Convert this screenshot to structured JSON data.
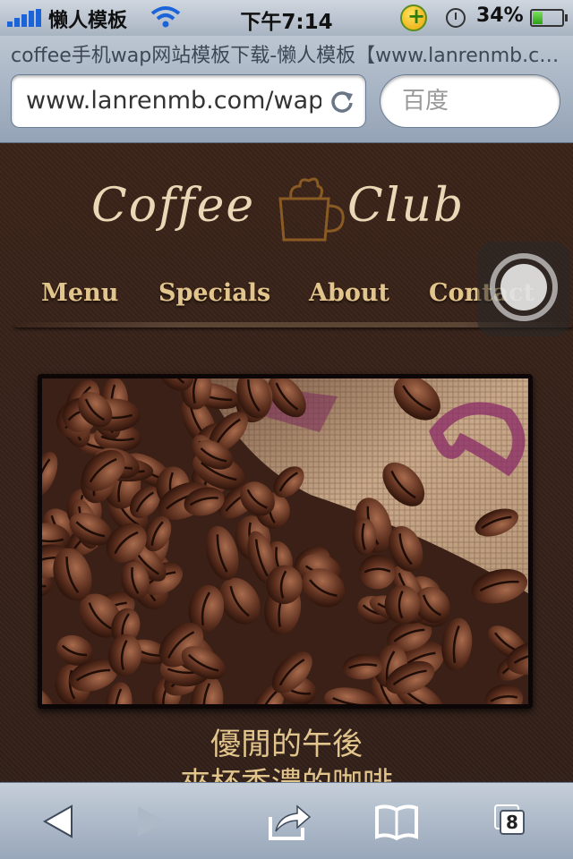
{
  "status_bar": {
    "carrier": "懒人模板",
    "time": "下午7:14",
    "battery_percent": "34%",
    "battery_level": 0.34,
    "icons": [
      "signal-icon",
      "wifi-icon",
      "app-notification-icon",
      "alarm-clock-icon",
      "battery-icon"
    ]
  },
  "browser": {
    "page_title": "coffee手机wap网站模板下载-懒人模板【www.lanrenmb.com】",
    "url": "www.lanrenmb.com/wap",
    "search_placeholder": "百度"
  },
  "site": {
    "logo_word_1": "Coffee",
    "logo_word_2": "Club",
    "nav": [
      {
        "label": "Menu"
      },
      {
        "label": "Specials"
      },
      {
        "label": "About"
      },
      {
        "label": "Contact"
      }
    ],
    "hero_alt": "coffee-beans-photo",
    "caption_line_1": "優閒的午後",
    "caption_line_2": "來杯香濃的咖啡"
  },
  "toolbar": {
    "tab_count": "8",
    "icons": [
      "back-icon",
      "forward-icon",
      "share-icon",
      "bookmarks-icon",
      "tabs-icon"
    ]
  },
  "colors": {
    "page_background": "#37231a",
    "nav_text": "#e2c58c",
    "logo_text": "#e9d7b6"
  }
}
